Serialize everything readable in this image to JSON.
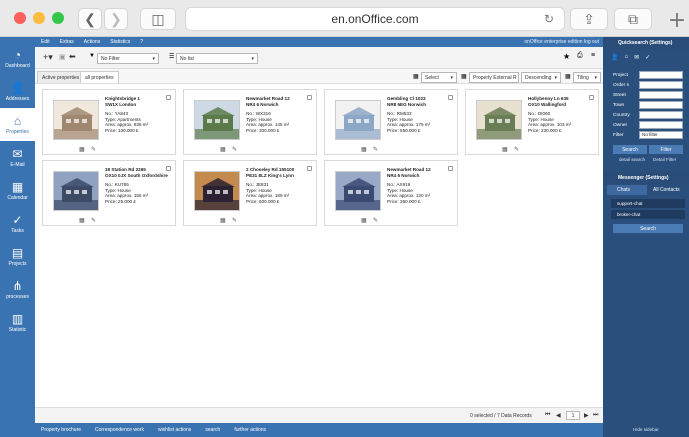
{
  "browser": {
    "url": "en.onOffice.com"
  },
  "nav": [
    {
      "label": "Dashboard",
      "icon": "dashboard-icon",
      "glyph": "◔"
    },
    {
      "label": "Addresses",
      "icon": "person-icon",
      "glyph": "👤"
    },
    {
      "label": "Properties",
      "icon": "house-icon",
      "glyph": "⌂"
    },
    {
      "label": "E-Mail",
      "icon": "envelope-icon",
      "glyph": "✉"
    },
    {
      "label": "Calendar",
      "icon": "calendar-icon",
      "glyph": "▦"
    },
    {
      "label": "Tasks",
      "icon": "check-icon",
      "glyph": "✓"
    },
    {
      "label": "Projects",
      "icon": "projects-icon",
      "glyph": "▤"
    },
    {
      "label": "processes",
      "icon": "process-icon",
      "glyph": "⋔"
    },
    {
      "label": "Statistic",
      "icon": "statistic-icon",
      "glyph": "▥"
    }
  ],
  "menu": [
    "Edit",
    "Extras",
    "Actions",
    "Statistics",
    "?"
  ],
  "topright": "onOffice enterprise edition   log out",
  "toolbar": {
    "filter": "No Filter",
    "list": "No list"
  },
  "tabs": [
    "Active properties",
    "all properties"
  ],
  "controls": {
    "select": "Select",
    "sort_field": "Property External R",
    "order": "Descending",
    "view": "Tiling"
  },
  "cards": [
    {
      "title": "Knightsbridge 1",
      "addr": "SW1X London",
      "no": "No.: YA843",
      "type": "Type: Apartments",
      "area": "Area: approx. 836 m²",
      "price": "Price: 100.000 £"
    },
    {
      "title": "Newmarket Road 12",
      "addr": "NR4 6 Norwich",
      "no": "No.: WX316",
      "type": "Type: House",
      "area": "Area: approx. 145 m²",
      "price": "Price: 300.000 £"
    },
    {
      "title": "Gembling Cl 1023",
      "addr": "NR8 6EG Norwich",
      "no": "No.: RM533",
      "type": "Type: House",
      "area": "Area: approx. 175 m²",
      "price": "Price: 550.000 £"
    },
    {
      "title": "Hollybenny Ln 635",
      "addr": "OX10 Wallingford",
      "no": "No.: OI060",
      "type": "Type: House",
      "area": "Area: approx. 103 m²",
      "price": "Price: 230.000 £"
    },
    {
      "title": "18 Station Rd 2265",
      "addr": "OX10 0JX South Oxfordshire",
      "no": "No.: KU765",
      "type": "Type: House",
      "area": "Area: approx. 155 m²",
      "price": "Price: 25.000 £"
    },
    {
      "title": "2 Choseley Rd 155100",
      "addr": "PE31 8LZ King's Lynn",
      "no": "No.: JE831",
      "type": "Type: House",
      "area": "Area: approx. 189 m²",
      "price": "Price: 600.000 £"
    },
    {
      "title": "Newmarket Road 12",
      "addr": "NR4 6 Norwich",
      "no": "No.: AX919",
      "type": "Type: House",
      "area": "Area: approx. 120 m²",
      "price": "Price: 360.000 £"
    }
  ],
  "status": {
    "records": "0 selected / 7 Data Records",
    "page": "1"
  },
  "bottom": [
    "Property brochure",
    "Correspondence work",
    "wishlist actions",
    "search",
    "further actions"
  ],
  "quicksearch": {
    "title": "Quicksearch (Settings)",
    "fields": [
      "Project",
      "Order s",
      "Street",
      "Town",
      "Country",
      "Owner",
      "Filter"
    ],
    "filter_value": "No filter",
    "search_btn": "Search",
    "filter_btn": "Filter",
    "detail_search": "detail search",
    "detail_filter": "Detail Filter"
  },
  "messenger": {
    "title": "Messenger (Settings)",
    "chats": "Chats",
    "contacts": "All Contacts",
    "items": [
      "support-chat",
      "broker-chat"
    ],
    "search_btn": "Search",
    "footer": "Hide sidebar"
  }
}
